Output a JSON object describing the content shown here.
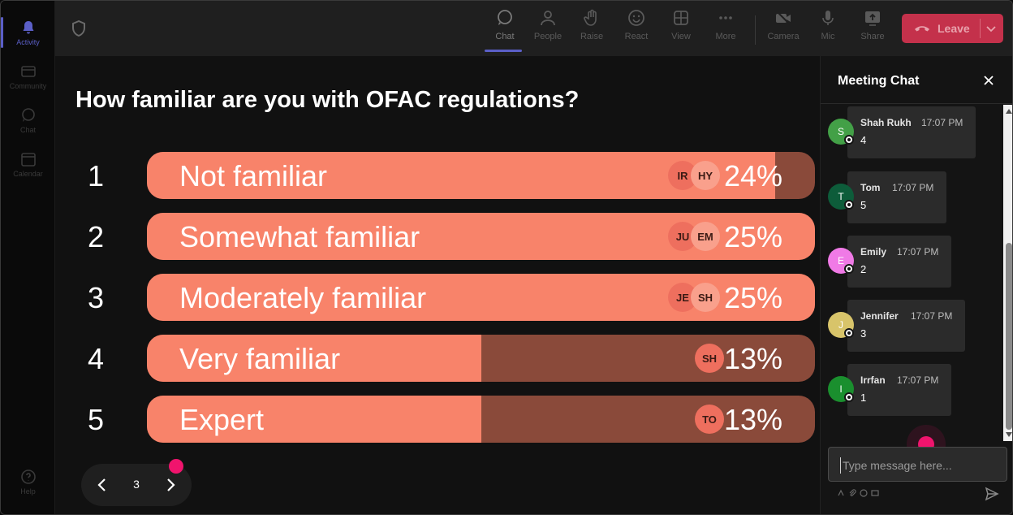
{
  "rail": {
    "items": [
      {
        "label": "Activity"
      },
      {
        "label": "Community"
      },
      {
        "label": "Chat"
      },
      {
        "label": "Calendar"
      }
    ],
    "help_label": "Help"
  },
  "toolbar": {
    "chat": "Chat",
    "people": "People",
    "raise": "Raise",
    "react": "React",
    "view": "View",
    "more": "More",
    "camera": "Camera",
    "mic": "Mic",
    "share": "Share",
    "leave": "Leave"
  },
  "poll": {
    "question": "How familiar are you with OFAC regulations?",
    "options": [
      {
        "num": "1",
        "label": "Not familiar",
        "pct": "24%",
        "fill": 0.94,
        "avatars": [
          "IR",
          "HY"
        ]
      },
      {
        "num": "2",
        "label": "Somewhat familiar",
        "pct": "25%",
        "fill": 1.0,
        "avatars": [
          "JU",
          "EM"
        ]
      },
      {
        "num": "3",
        "label": "Moderately familiar",
        "pct": "25%",
        "fill": 1.0,
        "avatars": [
          "JE",
          "SH"
        ]
      },
      {
        "num": "4",
        "label": "Very familiar",
        "pct": "13%",
        "fill": 0.5,
        "avatars": [
          "SH"
        ]
      },
      {
        "num": "5",
        "label": "Expert",
        "pct": "13%",
        "fill": 0.5,
        "avatars": [
          "TO"
        ]
      }
    ],
    "page": "3"
  },
  "chat": {
    "title": "Meeting Chat",
    "messages": [
      {
        "initial": "S",
        "name": "Shah Rukh",
        "time": "17:07 PM",
        "text": "4",
        "color": "#43a047"
      },
      {
        "initial": "T",
        "name": "Tom",
        "time": "17:07 PM",
        "text": "5",
        "color": "#0d5c3a"
      },
      {
        "initial": "E",
        "name": "Emily",
        "time": "17:07 PM",
        "text": "2",
        "color": "#f07ae6"
      },
      {
        "initial": "J",
        "name": "Jennifer",
        "time": "17:07 PM",
        "text": "3",
        "color": "#d8c46a"
      },
      {
        "initial": "I",
        "name": "Irrfan",
        "time": "17:07 PM",
        "text": "1",
        "color": "#1a8f2e"
      }
    ],
    "compose_placeholder": "Type message here..."
  },
  "colors": {
    "bar_fill": "#f8836a",
    "bar_track": "#8a4a3a",
    "leave_button": "#c4314b",
    "accent": "#5b5fc7",
    "indicator_dot": "#f0146d"
  }
}
